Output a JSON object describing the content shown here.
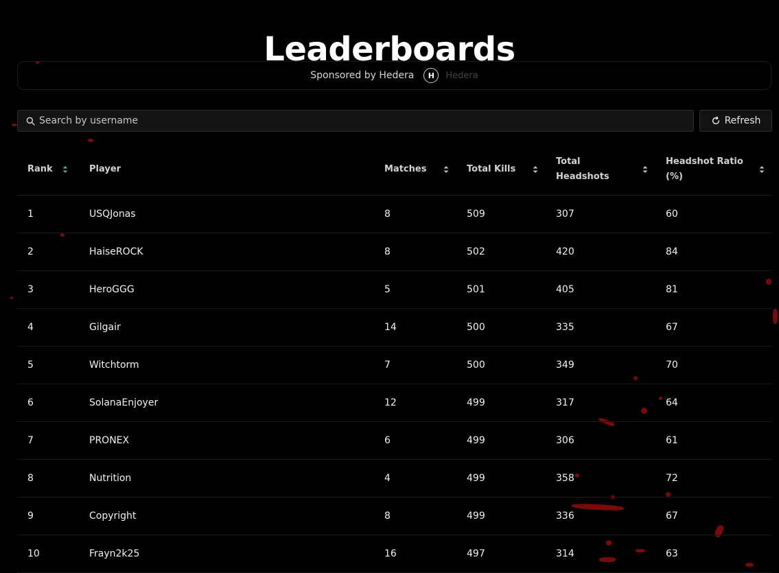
{
  "page": {
    "title": "Leaderboards"
  },
  "sponsor": {
    "text": "Sponsored by Hedera",
    "logo_icon": "hedera-logo-icon",
    "logo_letter": "H",
    "logo_name": "Hedera"
  },
  "search": {
    "placeholder": "Search by username",
    "value": ""
  },
  "refresh": {
    "label": "Refresh"
  },
  "table": {
    "columns": [
      "Rank",
      "Player",
      "Matches",
      "Total Kills",
      "Total Headshots",
      "Headshot Ratio (%)"
    ],
    "sorted_by": "Rank",
    "rows": [
      [
        "1",
        "USQJonas",
        "8",
        "509",
        "307",
        "60"
      ],
      [
        "2",
        "HaiseROCK",
        "8",
        "502",
        "420",
        "84"
      ],
      [
        "3",
        "HeroGGG",
        "5",
        "501",
        "405",
        "81"
      ],
      [
        "4",
        "Gilgair",
        "14",
        "500",
        "335",
        "67"
      ],
      [
        "5",
        "Witchtorm",
        "7",
        "500",
        "349",
        "70"
      ],
      [
        "6",
        "SolanaEnjoyer",
        "12",
        "499",
        "317",
        "64"
      ],
      [
        "7",
        "PRONEX",
        "6",
        "499",
        "306",
        "61"
      ],
      [
        "8",
        "Nutrition",
        "4",
        "499",
        "358",
        "72"
      ],
      [
        "9",
        "Copyright",
        "8",
        "499",
        "336",
        "67"
      ],
      [
        "10",
        "Frayn2k25",
        "16",
        "497",
        "314",
        "63"
      ]
    ]
  },
  "colors": {
    "background": "#000000",
    "text": "#ffffff",
    "accent_sort": "#3fbf7f",
    "blood": "#7a0a0a"
  }
}
